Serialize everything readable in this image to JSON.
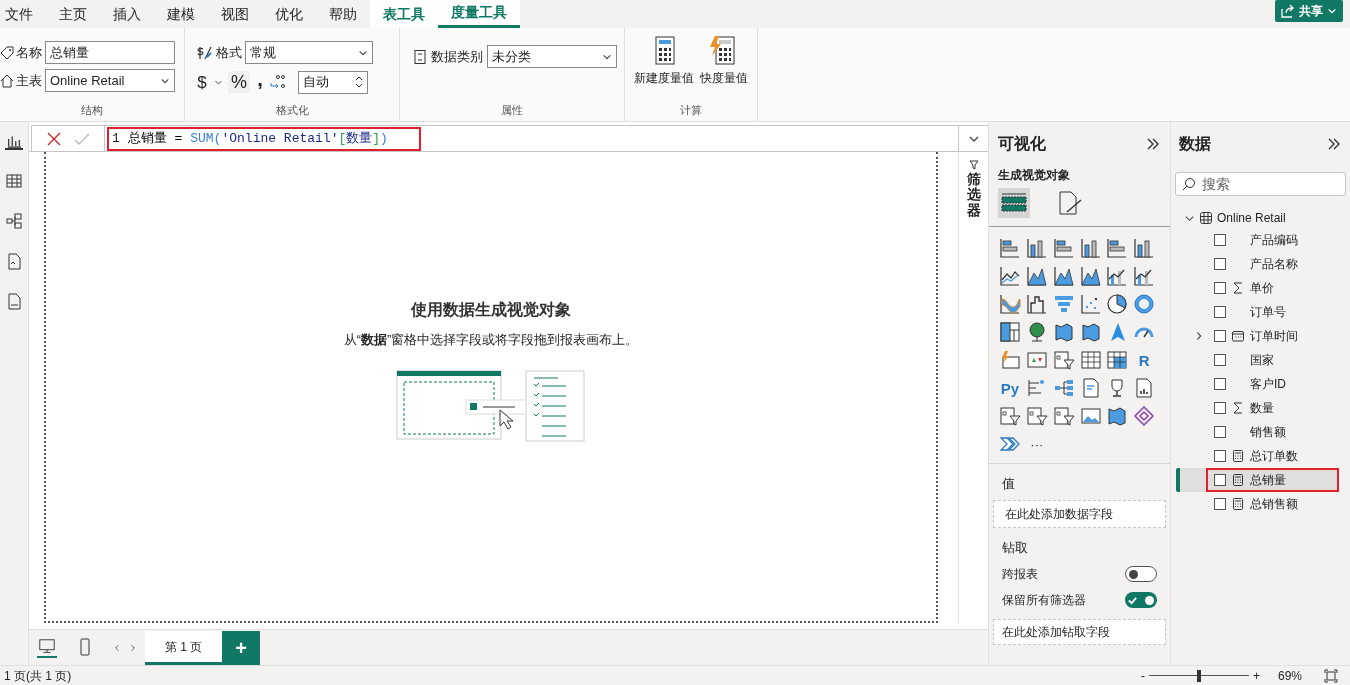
{
  "ribbon_tabs": [
    {
      "label": "文件",
      "selected": false,
      "contextual": false
    },
    {
      "label": "主页",
      "selected": false,
      "contextual": false
    },
    {
      "label": "插入",
      "selected": false,
      "contextual": false
    },
    {
      "label": "建模",
      "selected": false,
      "contextual": false
    },
    {
      "label": "视图",
      "selected": false,
      "contextual": false
    },
    {
      "label": "优化",
      "selected": false,
      "contextual": false
    },
    {
      "label": "帮助",
      "selected": false,
      "contextual": false
    },
    {
      "label": "表工具",
      "selected": false,
      "contextual": true
    },
    {
      "label": "度量工具",
      "selected": true,
      "contextual": true
    }
  ],
  "share_button": {
    "label": "共享"
  },
  "structure": {
    "label": "结构",
    "name_label": "名称",
    "name_value": "总销量",
    "home_table_label": "主表",
    "home_table_value": "Online Retail"
  },
  "formatting": {
    "label": "格式化",
    "format_label": "格式",
    "format_value": "常规",
    "currency": "$",
    "percent": "%",
    "comma": ",",
    "decimal_value": "自动"
  },
  "properties": {
    "label": "属性",
    "category_label": "数据类别",
    "category_value": "未分类"
  },
  "calculations": {
    "label": "计算",
    "buttons": [
      {
        "label": "新建度量值",
        "kind": "new"
      },
      {
        "label": "快度量值",
        "kind": "quick"
      }
    ]
  },
  "views": [
    {
      "kind": "report",
      "selected": true
    },
    {
      "kind": "table",
      "selected": false
    },
    {
      "kind": "model",
      "selected": false
    },
    {
      "kind": "dax",
      "selected": false
    },
    {
      "kind": "tmdl",
      "selected": false
    }
  ],
  "formula": {
    "line_number": "1",
    "highlighted": true,
    "tokens": [
      {
        "text": "总销量 = ",
        "kind": "name"
      },
      {
        "text": "SUM(",
        "kind": "function"
      },
      {
        "text": "'Online Retail'",
        "kind": "table"
      },
      {
        "text": "[",
        "kind": "bracket"
      },
      {
        "text": "数量",
        "kind": "table"
      },
      {
        "text": "]",
        "kind": "bracket"
      },
      {
        "text": ")",
        "kind": "function"
      }
    ]
  },
  "canvas": {
    "title": "使用数据生成视觉对象",
    "description": "从“**数据**”窗格中选择字段或将字段拖到报表画布上。"
  },
  "filters_pane": {
    "label": "筛选器"
  },
  "visualizations": {
    "title": "可视化",
    "subtitle": "生成视觉对象",
    "tabs": [
      {
        "kind": "build",
        "selected": true
      },
      {
        "kind": "format",
        "selected": false
      }
    ],
    "gallery": [
      {
        "kind": "bar"
      },
      {
        "kind": "column"
      },
      {
        "kind": "bar"
      },
      {
        "kind": "column"
      },
      {
        "kind": "bar"
      },
      {
        "kind": "column"
      },
      {
        "kind": "line"
      },
      {
        "kind": "area"
      },
      {
        "kind": "area"
      },
      {
        "kind": "area"
      },
      {
        "kind": "combo"
      },
      {
        "kind": "combo"
      },
      {
        "kind": "ribbon"
      },
      {
        "kind": "waterfall"
      },
      {
        "kind": "funnel"
      },
      {
        "kind": "scatter"
      },
      {
        "kind": "pie"
      },
      {
        "kind": "donut"
      },
      {
        "kind": "treemap"
      },
      {
        "kind": "globe"
      },
      {
        "kind": "map"
      },
      {
        "kind": "map"
      },
      {
        "kind": "arrow"
      },
      {
        "kind": "gauge"
      },
      {
        "kind": "card"
      },
      {
        "kind": "kpi"
      },
      {
        "kind": "slicer"
      },
      {
        "kind": "table"
      },
      {
        "kind": "matrix"
      },
      {
        "kind": "letter",
        "label": "R"
      },
      {
        "kind": "letter",
        "label": "Py"
      },
      {
        "kind": "influencers"
      },
      {
        "kind": "decomposition"
      },
      {
        "kind": "narrative"
      },
      {
        "kind": "trophy"
      },
      {
        "kind": "report"
      },
      {
        "kind": "slicer"
      },
      {
        "kind": "slicer"
      },
      {
        "kind": "slicer"
      },
      {
        "kind": "image"
      },
      {
        "kind": "map"
      },
      {
        "kind": "diamond"
      },
      {
        "kind": "chevrons"
      },
      {
        "kind": "more",
        "label": "···"
      }
    ],
    "values_label": "值",
    "values_well": "在此处添加数据字段",
    "drillthrough_label": "钻取",
    "toggles": [
      {
        "label": "跨报表",
        "on": false
      },
      {
        "label": "保留所有筛选器",
        "on": true
      }
    ],
    "drill_well": "在此处添加钻取字段"
  },
  "data": {
    "title": "数据",
    "search_placeholder": "搜索",
    "tables": [
      {
        "name": "Online Retail",
        "expanded": true,
        "fields": [
          {
            "name": "产品编码",
            "kind": "plain",
            "expandable": false,
            "checked": false,
            "selected": false,
            "highlighted": false
          },
          {
            "name": "产品名称",
            "kind": "plain",
            "expandable": false,
            "checked": false,
            "selected": false,
            "highlighted": false
          },
          {
            "name": "单价",
            "kind": "sum",
            "expandable": false,
            "checked": false,
            "selected": false,
            "highlighted": false
          },
          {
            "name": "订单号",
            "kind": "plain",
            "expandable": false,
            "checked": false,
            "selected": false,
            "highlighted": false
          },
          {
            "name": "订单时间",
            "kind": "date",
            "expandable": true,
            "checked": false,
            "selected": false,
            "highlighted": false
          },
          {
            "name": "国家",
            "kind": "plain",
            "expandable": false,
            "checked": false,
            "selected": false,
            "highlighted": false
          },
          {
            "name": "客户ID",
            "kind": "plain",
            "expandable": false,
            "checked": false,
            "selected": false,
            "highlighted": false
          },
          {
            "name": "数量",
            "kind": "sum",
            "expandable": false,
            "checked": false,
            "selected": false,
            "highlighted": false
          },
          {
            "name": "销售额",
            "kind": "plain",
            "expandable": false,
            "checked": false,
            "selected": false,
            "highlighted": false
          },
          {
            "name": "总订单数",
            "kind": "measure",
            "expandable": false,
            "checked": false,
            "selected": false,
            "highlighted": false
          },
          {
            "name": "总销量",
            "kind": "measure",
            "expandable": false,
            "checked": false,
            "selected": true,
            "highlighted": true
          },
          {
            "name": "总销售额",
            "kind": "measure",
            "expandable": false,
            "checked": false,
            "selected": false,
            "highlighted": false
          }
        ]
      }
    ]
  },
  "devices": [
    {
      "kind": "desktop",
      "selected": true
    },
    {
      "kind": "phone",
      "selected": false
    }
  ],
  "pages": [
    {
      "label": "第 1 页",
      "selected": true
    }
  ],
  "add_page": "+",
  "status": {
    "page_info": "1 页(共 1 页)",
    "zoom_out": "-",
    "zoom_in": "+",
    "zoom": {
      "level": 0.5
    },
    "zoom_label": "69%"
  }
}
